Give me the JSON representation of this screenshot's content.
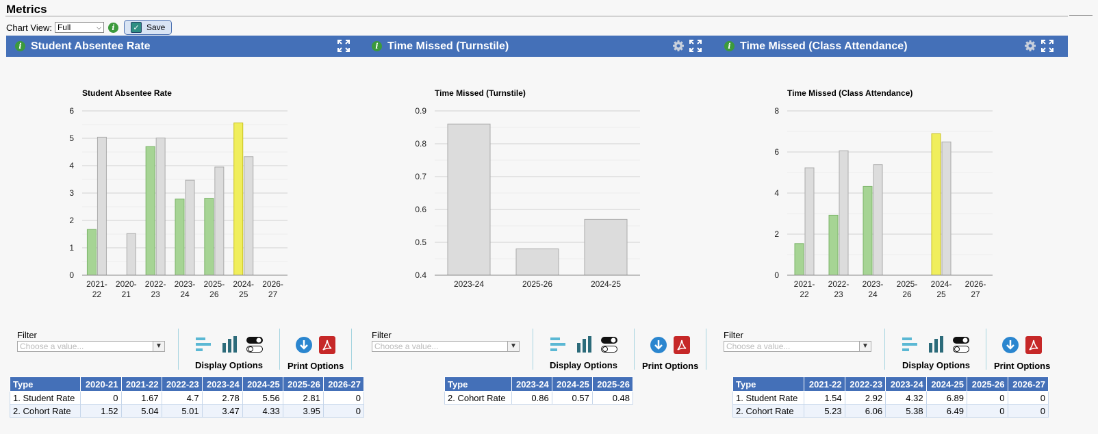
{
  "page": {
    "title": "Metrics"
  },
  "toolbar": {
    "chart_view_label": "Chart View:",
    "chart_view_value": "Full",
    "save_label": "Save"
  },
  "panels": [
    {
      "header": "Student Absentee Rate",
      "chart_title": "Student Absentee Rate"
    },
    {
      "header": "Time Missed (Turnstile)",
      "chart_title": "Time Missed (Turnstile)"
    },
    {
      "header": "Time Missed (Class Attendance)",
      "chart_title": "Time Missed (Class Attendance)"
    }
  ],
  "controls": {
    "filter_label": "Filter",
    "filter_placeholder": "Choose a value...",
    "display_options": "Display Options",
    "print_options": "Print Options"
  },
  "chart_data": [
    {
      "type": "bar",
      "title": "Student Absentee Rate",
      "categories": [
        "2021-22",
        "2020-21",
        "2022-23",
        "2023-24",
        "2025-26",
        "2024-25",
        "2026-27"
      ],
      "series": [
        {
          "values": [
            1.67,
            0,
            4.7,
            2.78,
            2.81,
            5.56,
            0
          ],
          "color": "#a6d494",
          "highlight_color": "#f0ee5c"
        },
        {
          "values": [
            5.04,
            1.52,
            5.01,
            3.47,
            3.95,
            4.33,
            0
          ],
          "color": "#dcdcdc"
        }
      ],
      "highlight_index": 5,
      "ylim": [
        0,
        6
      ],
      "yticks": [
        0,
        1,
        2,
        3,
        4,
        5,
        6
      ],
      "grid": true
    },
    {
      "type": "bar",
      "title": "Time Missed (Turnstile)",
      "categories": [
        "2023-24",
        "2025-26",
        "2024-25"
      ],
      "series": [
        {
          "values": [
            0.86,
            0.48,
            0.57
          ],
          "color": "#dcdcdc"
        }
      ],
      "ylim": [
        0.4,
        0.9
      ],
      "yticks": [
        0.4,
        0.5,
        0.6,
        0.7,
        0.8,
        0.9
      ],
      "grid": true
    },
    {
      "type": "bar",
      "title": "Time Missed (Class Attendance)",
      "categories": [
        "2021-22",
        "2022-23",
        "2023-24",
        "2025-26",
        "2024-25",
        "2026-27"
      ],
      "series": [
        {
          "values": [
            1.54,
            2.92,
            4.32,
            0,
            6.89,
            0
          ],
          "color": "#a6d494",
          "highlight_color": "#f0ee5c"
        },
        {
          "values": [
            5.23,
            6.06,
            5.38,
            0,
            6.49,
            0
          ],
          "color": "#dcdcdc"
        }
      ],
      "highlight_index": 4,
      "ylim": [
        0,
        8
      ],
      "yticks": [
        0,
        2,
        4,
        6,
        8
      ],
      "grid": true
    }
  ],
  "tables": [
    {
      "headers": [
        "Type",
        "2020-21",
        "2021-22",
        "2022-23",
        "2023-24",
        "2024-25",
        "2025-26",
        "2026-27"
      ],
      "rows": [
        [
          "1. Student Rate",
          "0",
          "1.67",
          "4.7",
          "2.78",
          "5.56",
          "2.81",
          "0"
        ],
        [
          "2. Cohort Rate",
          "1.52",
          "5.04",
          "5.01",
          "3.47",
          "4.33",
          "3.95",
          "0"
        ]
      ]
    },
    {
      "headers": [
        "Type",
        "2023-24",
        "2024-25",
        "2025-26"
      ],
      "rows": [
        [
          "2. Cohort Rate",
          "0.86",
          "0.57",
          "0.48"
        ]
      ]
    },
    {
      "headers": [
        "Type",
        "2021-22",
        "2022-23",
        "2023-24",
        "2024-25",
        "2025-26",
        "2026-27"
      ],
      "rows": [
        [
          "1. Student Rate",
          "1.54",
          "2.92",
          "4.32",
          "6.89",
          "0",
          "0"
        ],
        [
          "2. Cohort Rate",
          "5.23",
          "6.06",
          "5.38",
          "6.49",
          "0",
          "0"
        ]
      ]
    }
  ]
}
